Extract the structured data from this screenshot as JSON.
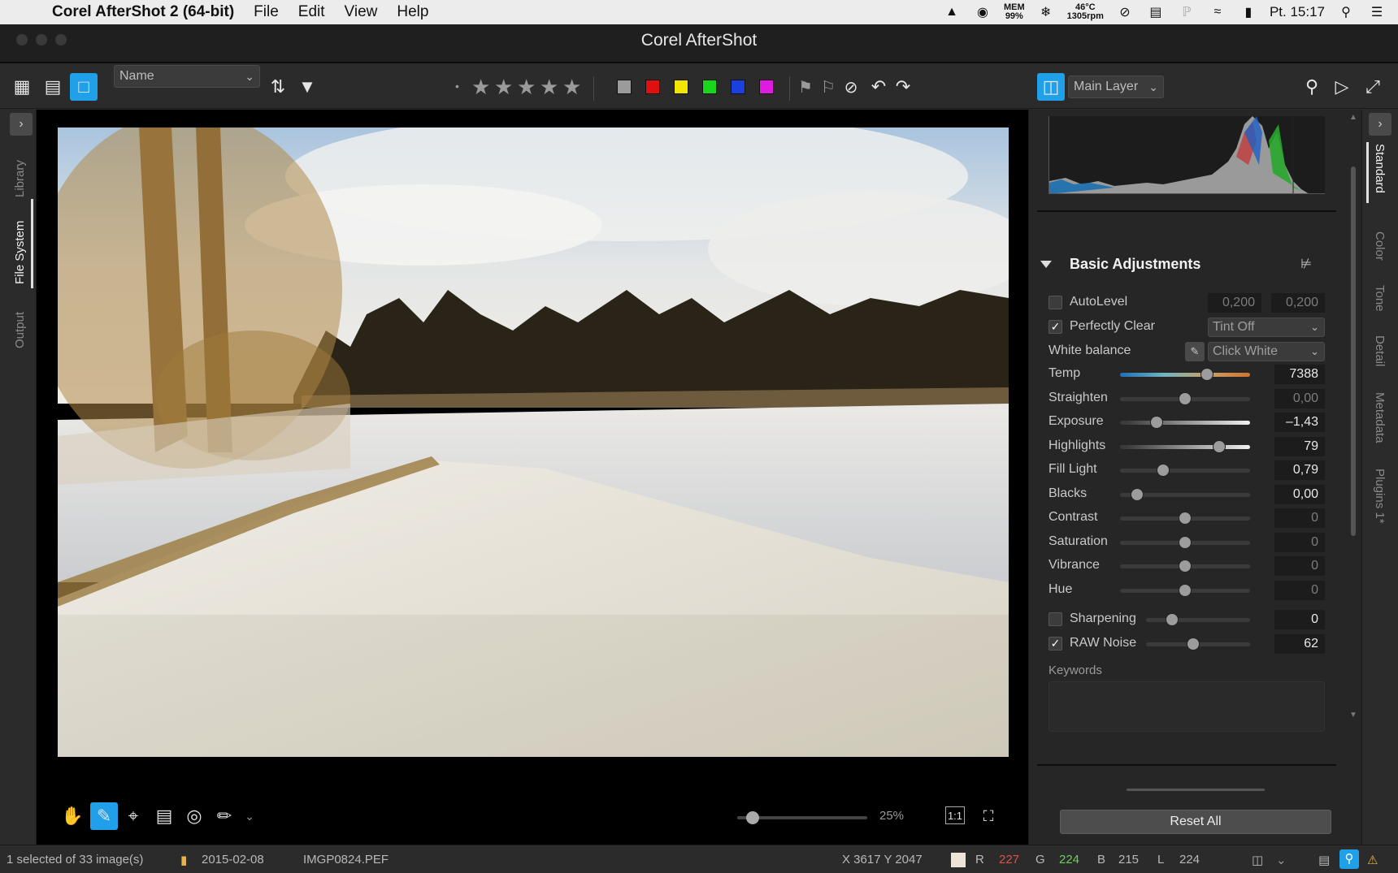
{
  "menubar": {
    "app_name": "Corel AfterShot 2 (64-bit)",
    "menus": [
      "File",
      "Edit",
      "View",
      "Help"
    ],
    "mem_label": "MEM",
    "mem_value": "99%",
    "temp_value": "46°C",
    "rpm_value": "1305rpm",
    "clock": "Pt. 15:17"
  },
  "window": {
    "title": "Corel AfterShot"
  },
  "toolbar": {
    "sort_select": "Name",
    "layer_select": "Main Layer",
    "color_labels": [
      "#9b9b9b",
      "#e01010",
      "#f2e600",
      "#1ad61a",
      "#1c3fe0",
      "#e01ae0"
    ]
  },
  "left_tabs": [
    "Library",
    "File System",
    "Output"
  ],
  "right_tabs": [
    "Standard",
    "Color",
    "Tone",
    "Detail",
    "Metadata",
    "Plugins 1*"
  ],
  "panel": {
    "section_title": "Basic Adjustments",
    "autolevel": {
      "label": "AutoLevel",
      "value1": "0,200",
      "value2": "0,200",
      "checked": false
    },
    "perfectly_clear": {
      "label": "Perfectly Clear",
      "dropdown": "Tint Off",
      "checked": true
    },
    "white_balance": {
      "label": "White balance",
      "dropdown": "Click White"
    },
    "sliders": [
      {
        "label": "Temp",
        "value": "7388",
        "pos": 0.67,
        "dim": false
      },
      {
        "label": "Straighten",
        "value": "0,00",
        "pos": 0.5,
        "dim": true
      },
      {
        "label": "Exposure",
        "value": "–1,43",
        "pos": 0.28,
        "dim": false
      },
      {
        "label": "Highlights",
        "value": "79",
        "pos": 0.76,
        "dim": false
      },
      {
        "label": "Fill Light",
        "value": "0,79",
        "pos": 0.33,
        "dim": false
      },
      {
        "label": "Blacks",
        "value": "0,00",
        "pos": 0.13,
        "dim": false
      },
      {
        "label": "Contrast",
        "value": "0",
        "pos": 0.5,
        "dim": true
      },
      {
        "label": "Saturation",
        "value": "0",
        "pos": 0.5,
        "dim": true
      },
      {
        "label": "Vibrance",
        "value": "0",
        "pos": 0.5,
        "dim": true
      },
      {
        "label": "Hue",
        "value": "0",
        "pos": 0.5,
        "dim": true
      }
    ],
    "sharpening": {
      "label": "Sharpening",
      "value": "0",
      "pos": 0.25,
      "checked": false
    },
    "raw_noise": {
      "label": "RAW Noise",
      "value": "62",
      "pos": 0.45,
      "checked": true
    },
    "keywords_label": "Keywords",
    "reset_label": "Reset All"
  },
  "viewer": {
    "zoom": "25%",
    "zoom_pos": 0.12,
    "fit_label": "1:1"
  },
  "statusbar": {
    "selection": "1 selected of 33 image(s)",
    "folder": "2015-02-08",
    "filename": "IMGP0824.PEF",
    "coords": "X 3617  Y 2047",
    "r_label": "R",
    "r_value": "227",
    "g_label": "G",
    "g_value": "224",
    "b_label": "B",
    "b_value": "215",
    "l_label": "L",
    "l_value": "224"
  }
}
